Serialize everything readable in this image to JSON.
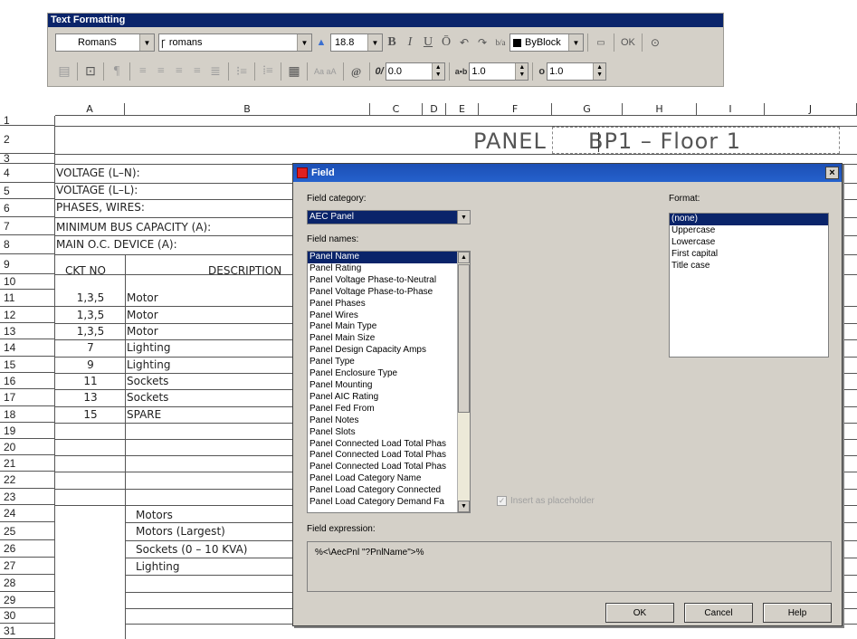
{
  "toolbar": {
    "title": "Text Formatting",
    "style_value": "RomanS",
    "font_value": "romans",
    "height_value": "18.8",
    "bold_label": "B",
    "italic_label": "I",
    "underline_label": "U",
    "overline_label": "Ō",
    "stack_label": "b/a",
    "color_value": "ByBlock",
    "ok_label": "OK",
    "case_label": "Aa aA",
    "symbol_label": "@",
    "oblique_label": "0/",
    "oblique_value": "0.0",
    "tracking_label": "a•b",
    "tracking_value": "1.0",
    "width_label": "o",
    "width_value": "1.0"
  },
  "sheet": {
    "columns": [
      "A",
      "B",
      "C",
      "D",
      "E",
      "F",
      "G",
      "H",
      "I",
      "J"
    ],
    "row_numbers": [
      "1",
      "2",
      "3",
      "4",
      "5",
      "6",
      "7",
      "8",
      "9",
      "10",
      "11",
      "12",
      "13",
      "14",
      "15",
      "16",
      "17",
      "18",
      "19",
      "20",
      "21",
      "22",
      "23",
      "24",
      "25",
      "26",
      "27",
      "28",
      "29",
      "30",
      "31"
    ],
    "panel_label": "PANEL",
    "panel_title": "BP1  –  Floor  1",
    "labels": [
      "VOLTAGE  (L–N):",
      "VOLTAGE  (L–L):",
      "PHASES,  WIRES:",
      "MINIMUM  BUS  CAPACITY  (A):",
      "MAIN  O.C.  DEVICE  (A):"
    ],
    "ckt_header": "CKT  NO",
    "desc_header": "DESCRIPTION",
    "circuits": [
      {
        "ckt": "1,3,5",
        "desc": "Motor"
      },
      {
        "ckt": "1,3,5",
        "desc": "Motor"
      },
      {
        "ckt": "1,3,5",
        "desc": "Motor"
      },
      {
        "ckt": "7",
        "desc": "Lighting"
      },
      {
        "ckt": "9",
        "desc": "Lighting"
      },
      {
        "ckt": "11",
        "desc": "Sockets"
      },
      {
        "ckt": "13",
        "desc": "Sockets"
      },
      {
        "ckt": "15",
        "desc": "SPARE"
      }
    ],
    "summary": [
      "Motors",
      "Motors  (Largest)",
      "Sockets  (0  –  10  KVA)",
      "Lighting"
    ]
  },
  "dialog": {
    "title": "Field",
    "close_label": "×",
    "category_label": "Field category:",
    "category_value": "AEC Panel",
    "names_label": "Field names:",
    "field_names": [
      "Panel Name",
      "Panel Rating",
      "Panel Voltage Phase-to-Neutral",
      "Panel Voltage Phase-to-Phase",
      "Panel Phases",
      "Panel Wires",
      "Panel Main Type",
      "Panel Main Size",
      "Panel Design Capacity Amps",
      "Panel Type",
      "Panel Enclosure Type",
      "Panel Mounting",
      "Panel AIC Rating",
      "Panel Fed From",
      "Panel Notes",
      "Panel Slots",
      "Panel Connected Load Total Phas",
      "Panel Connected Load Total Phas",
      "Panel Connected Load Total Phas",
      "Panel Load Category Name",
      "Panel Load Category Connected",
      "Panel Load Category Demand Fa"
    ],
    "format_label": "Format:",
    "formats": [
      "(none)",
      "Uppercase",
      "Lowercase",
      "First capital",
      "Title case"
    ],
    "placeholder_label": "Insert as placeholder",
    "expression_label": "Field expression:",
    "expression_value": "%<\\AecPnl \"?PnlName\">%",
    "ok_label": "OK",
    "cancel_label": "Cancel",
    "help_label": "Help"
  }
}
